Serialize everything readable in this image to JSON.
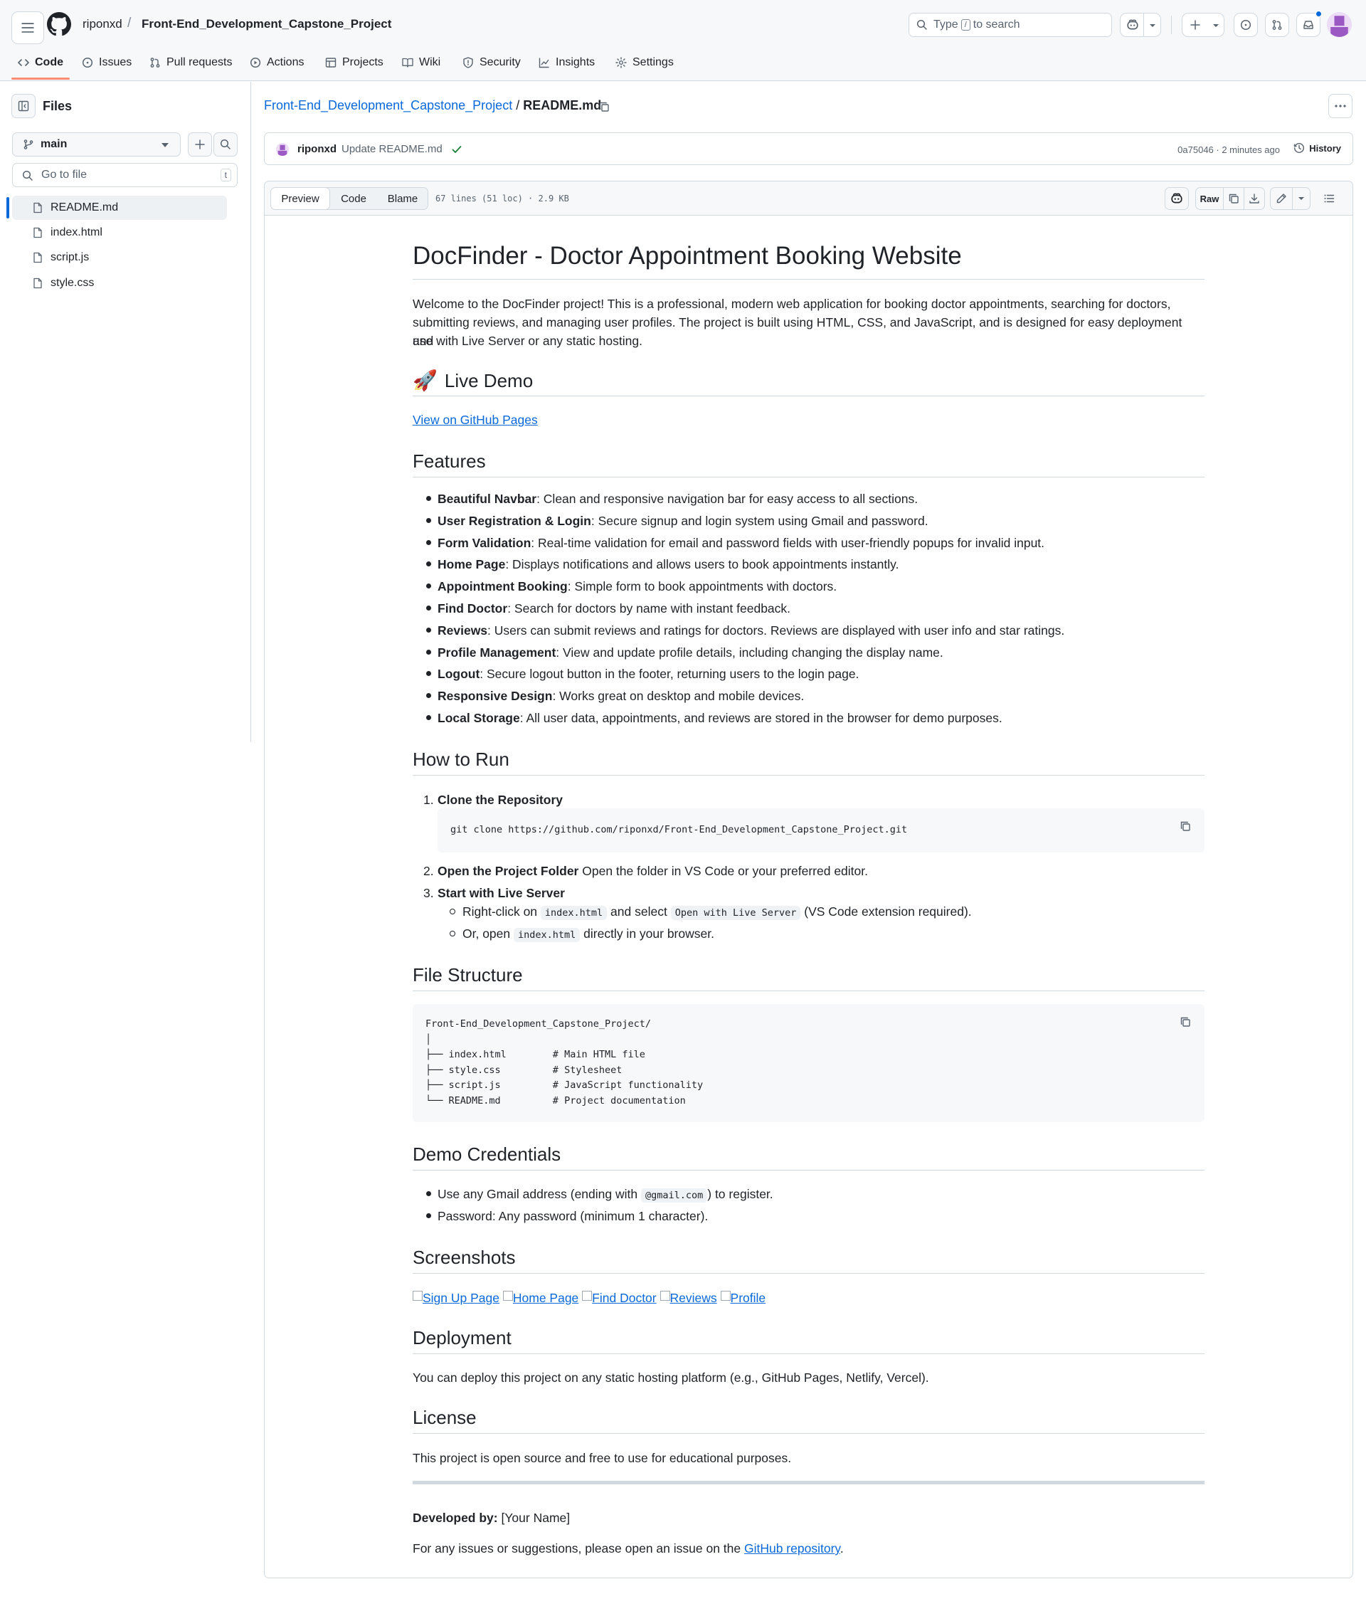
{
  "header": {
    "owner": "riponxd",
    "separator": "/",
    "repo": "Front-End_Development_Capstone_Project",
    "search_prefix": "Type",
    "search_key": "/",
    "search_suffix": "to search"
  },
  "tabs": [
    {
      "label": "Code",
      "icon": "code-icon"
    },
    {
      "label": "Issues",
      "icon": "issue-icon"
    },
    {
      "label": "Pull requests",
      "icon": "pull-request-icon"
    },
    {
      "label": "Actions",
      "icon": "play-icon"
    },
    {
      "label": "Projects",
      "icon": "table-icon"
    },
    {
      "label": "Wiki",
      "icon": "book-icon"
    },
    {
      "label": "Security",
      "icon": "shield-icon"
    },
    {
      "label": "Insights",
      "icon": "graph-icon"
    },
    {
      "label": "Settings",
      "icon": "gear-icon"
    }
  ],
  "sidebar": {
    "title": "Files",
    "branch": "main",
    "goto_placeholder": "Go to file",
    "goto_shortcut": "t",
    "files": [
      "README.md",
      "index.html",
      "script.js",
      "style.css"
    ],
    "active_file": "README.md"
  },
  "breadcrumb": {
    "repo": "Front-End_Development_Capstone_Project",
    "sep": "/",
    "file": "README.md"
  },
  "commit": {
    "user": "riponxd",
    "message": "Update README.md",
    "status": "success",
    "sha_time": "0a75046 · 2 minutes ago",
    "history_label": "History"
  },
  "file_header": {
    "views": [
      "Preview",
      "Code",
      "Blame"
    ],
    "active_view": "Preview",
    "info": "67 lines (51 loc) · 2.9 KB",
    "raw_label": "Raw"
  },
  "readme": {
    "title": "DocFinder - Doctor Appointment Booking Website",
    "intro_lines": [
      "Welcome to the DocFinder project! This is a professional, modern web application for booking doctor appointments, searching for doctors,",
      "submitting reviews, and managing user profiles. The project is built using HTML, CSS, and JavaScript, and is designed for easy deployment and",
      "use with Live Server or any static hosting."
    ],
    "live_demo": {
      "emoji": "🚀",
      "heading": "Live Demo",
      "link": "View on GitHub Pages"
    },
    "features_heading": "Features",
    "features": [
      {
        "name": "Beautiful Navbar",
        "desc": ": Clean and responsive navigation bar for easy access to all sections."
      },
      {
        "name": "User Registration & Login",
        "desc": ": Secure signup and login system using Gmail and password."
      },
      {
        "name": "Form Validation",
        "desc": ": Real-time validation for email and password fields with user-friendly popups for invalid input."
      },
      {
        "name": "Home Page",
        "desc": ": Displays notifications and allows users to book appointments instantly."
      },
      {
        "name": "Appointment Booking",
        "desc": ": Simple form to book appointments with doctors."
      },
      {
        "name": "Find Doctor",
        "desc": ": Search for doctors by name with instant feedback."
      },
      {
        "name": "Reviews",
        "desc": ": Users can submit reviews and ratings for doctors. Reviews are displayed with user info and star ratings."
      },
      {
        "name": "Profile Management",
        "desc": ": View and update profile details, including changing the display name."
      },
      {
        "name": "Logout",
        "desc": ": Secure logout button in the footer, returning users to the login page."
      },
      {
        "name": "Responsive Design",
        "desc": ": Works great on desktop and mobile devices."
      },
      {
        "name": "Local Storage",
        "desc": ": All user data, appointments, and reviews are stored in the browser for demo purposes."
      }
    ],
    "how_heading": "How to Run",
    "step1": {
      "num": "1.",
      "title": "Clone the Repository",
      "code": "git clone https://github.com/riponxd/Front-End_Development_Capstone_Project.git"
    },
    "step2": {
      "num": "2.",
      "title": "Open the Project Folder",
      "desc": " Open the folder in VS Code or your preferred editor."
    },
    "step3": {
      "num": "3.",
      "title": "Start with Live Server",
      "sub1_a": "Right-click on ",
      "sub1_code1": "index.html",
      "sub1_b": " and select ",
      "sub1_code2": "Open with Live Server",
      "sub1_c": " (VS Code extension required).",
      "sub2_a": "Or, open ",
      "sub2_code": "index.html",
      "sub2_b": " directly in your browser."
    },
    "structure_heading": "File Structure",
    "structure_code": "Front-End_Development_Capstone_Project/\n│\n├── index.html        # Main HTML file\n├── style.css         # Stylesheet\n├── script.js         # JavaScript functionality\n└── README.md         # Project documentation",
    "creds_heading": "Demo Credentials",
    "creds1_a": "Use any Gmail address (ending with ",
    "creds1_code": "@gmail.com",
    "creds1_b": ") to register.",
    "creds2": "Password: Any password (minimum 1 character).",
    "screens_heading": "Screenshots",
    "screenshots": [
      "Sign Up Page",
      "Home Page",
      "Find Doctor",
      "Reviews",
      "Profile"
    ],
    "deploy_heading": "Deployment",
    "deploy_text": "You can deploy this project on any static hosting platform (e.g., GitHub Pages, Netlify, Vercel).",
    "license_heading": "License",
    "license_text": "This project is open source and free to use for educational purposes.",
    "dev_label": "Developed by:",
    "dev_value": " [Your Name]",
    "issues_a": "For any issues or suggestions, please open an issue on the ",
    "issues_link": "GitHub repository",
    "issues_b": "."
  },
  "colors": {
    "accent_link": "#0969da",
    "tab_underline": "#fd8c73",
    "success": "#1a7f37",
    "border": "#d1d9e0"
  }
}
